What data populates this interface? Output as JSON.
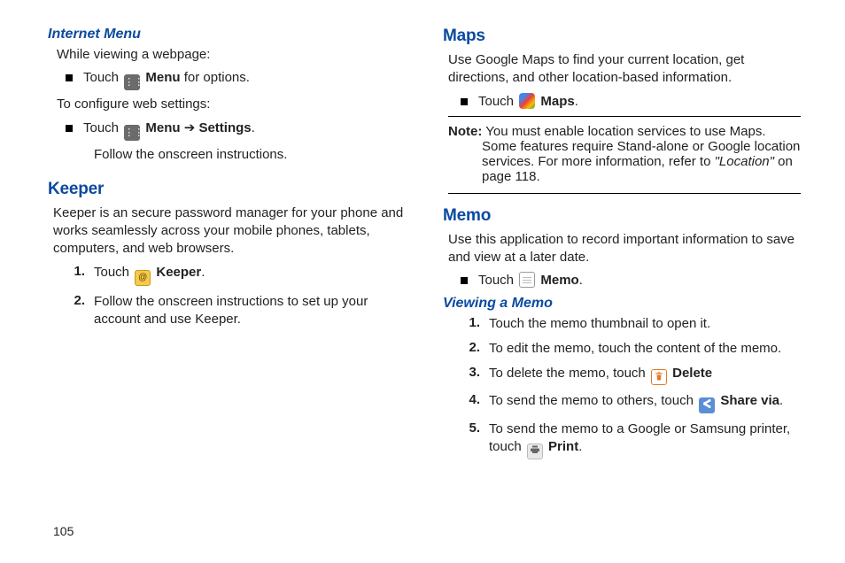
{
  "left": {
    "internet_menu": {
      "heading": "Internet Menu",
      "p1": "While viewing a webpage:",
      "b1_pre": "Touch ",
      "b1_label": "Menu",
      "b1_post": " for options.",
      "p2": "To configure web settings:",
      "b2_pre": "Touch ",
      "b2_label1": "Menu",
      "b2_arrow": " ➔ ",
      "b2_label2": "Settings",
      "b2_end": ".",
      "b2_follow": "Follow the onscreen instructions."
    },
    "keeper": {
      "heading": "Keeper",
      "intro": "Keeper is an secure password manager for your phone and works seamlessly across your mobile phones, tablets, computers, and web browsers.",
      "s1_num": "1.",
      "s1_pre": "Touch ",
      "s1_label": "Keeper",
      "s1_end": ".",
      "s2_num": "2.",
      "s2_text": "Follow the onscreen instructions to set up your account and use Keeper."
    }
  },
  "right": {
    "maps": {
      "heading": "Maps",
      "intro": "Use Google Maps to find your current location, get directions, and other location-based information.",
      "b1_pre": "Touch ",
      "b1_label": "Maps",
      "b1_end": ".",
      "note_lead": "Note:",
      "note_text_a": "You must enable location services to use Maps. Some features require Stand-alone or Google location services. For more information, refer to ",
      "note_ref": "\"Location\"",
      "note_text_b": " on page 118."
    },
    "memo": {
      "heading": "Memo",
      "intro": "Use this application to record important information to save and view at a later date.",
      "b1_pre": "Touch ",
      "b1_label": "Memo",
      "b1_end": ".",
      "viewing_heading": "Viewing a Memo",
      "s1_num": "1.",
      "s1_text": "Touch the memo thumbnail to open it.",
      "s2_num": "2.",
      "s2_text": "To edit the memo, touch the content of the memo.",
      "s3_num": "3.",
      "s3_pre": "To delete the memo, touch ",
      "s3_label": "Delete",
      "s4_num": "4.",
      "s4_pre": "To send the memo to others, touch ",
      "s4_label": "Share via",
      "s4_end": ".",
      "s5_num": "5.",
      "s5_pre": "To send the memo to a Google or Samsung printer, touch ",
      "s5_label": "Print",
      "s5_end": "."
    }
  },
  "page_number": "105"
}
